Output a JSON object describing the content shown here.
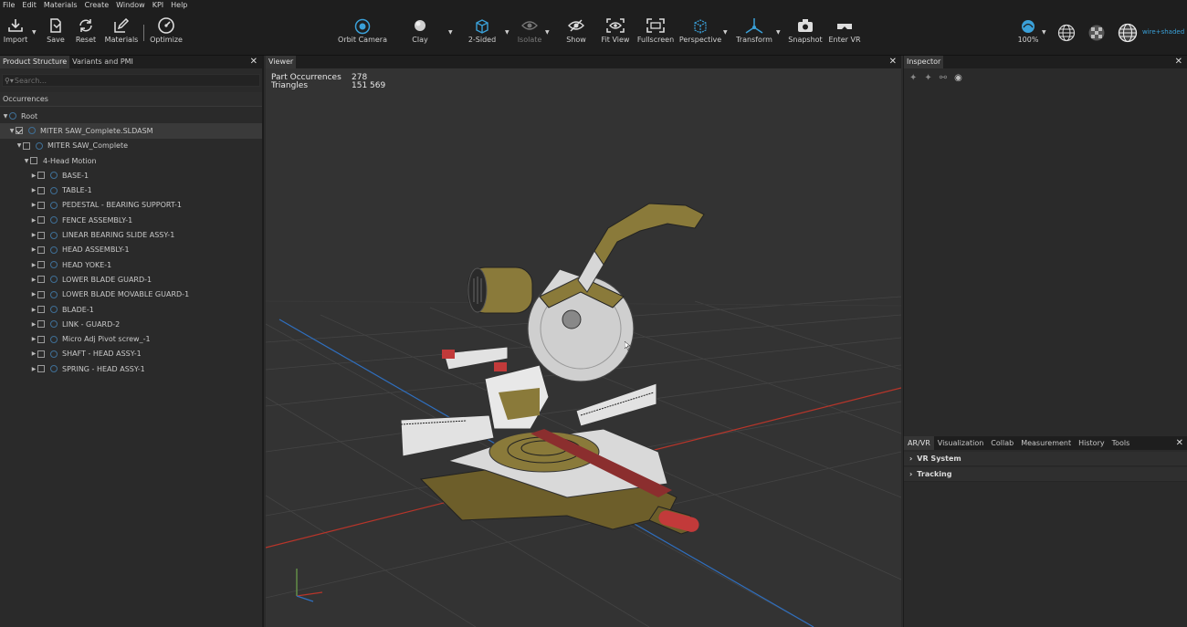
{
  "menu": [
    "File",
    "Edit",
    "Materials",
    "Create",
    "Window",
    "KPI",
    "Help"
  ],
  "toolbar": {
    "import": "Import",
    "save": "Save",
    "reset": "Reset",
    "materials": "Materials",
    "optimize": "Optimize",
    "orbit_camera": "Orbit Camera",
    "clay": "Clay",
    "two_sided": "2-Sided",
    "isolate": "Isolate",
    "show": "Show",
    "fit_view": "Fit View",
    "fullscreen": "Fullscreen",
    "perspective": "Perspective",
    "transform": "Transform",
    "snapshot": "Snapshot",
    "enter_vr": "Enter VR",
    "zoom": "100%",
    "render_mode": "wire+shaded"
  },
  "left_panel": {
    "tabs": [
      "Product Structure",
      "Variants and PMI"
    ],
    "search_placeholder": "Search...",
    "header": "Occurrences",
    "tree": [
      {
        "label": "Root",
        "depth": 0,
        "expanded": true,
        "has_checkbox": false
      },
      {
        "label": "MITER SAW_Complete.SLDASM",
        "depth": 1,
        "expanded": true,
        "has_checkbox": true,
        "checked": true,
        "selected": true
      },
      {
        "label": "MITER SAW_Complete",
        "depth": 2,
        "expanded": true,
        "has_checkbox": true,
        "checked": false
      },
      {
        "label": "4-Head Motion",
        "depth": 3,
        "expanded": true,
        "has_checkbox": true,
        "checked": false,
        "no_icon": true
      },
      {
        "label": "BASE-1",
        "depth": 4,
        "expanded": false,
        "has_checkbox": true,
        "checked": false
      },
      {
        "label": "TABLE-1",
        "depth": 4,
        "expanded": false,
        "has_checkbox": true,
        "checked": false
      },
      {
        "label": "PEDESTAL - BEARING SUPPORT-1",
        "depth": 4,
        "expanded": false,
        "has_checkbox": true,
        "checked": false
      },
      {
        "label": "FENCE ASSEMBLY-1",
        "depth": 4,
        "expanded": false,
        "has_checkbox": true,
        "checked": false
      },
      {
        "label": "LINEAR BEARING SLIDE ASSY-1",
        "depth": 4,
        "expanded": false,
        "has_checkbox": true,
        "checked": false
      },
      {
        "label": "HEAD ASSEMBLY-1",
        "depth": 4,
        "expanded": false,
        "has_checkbox": true,
        "checked": false
      },
      {
        "label": "HEAD YOKE-1",
        "depth": 4,
        "expanded": false,
        "has_checkbox": true,
        "checked": false
      },
      {
        "label": "LOWER BLADE GUARD-1",
        "depth": 4,
        "expanded": false,
        "has_checkbox": true,
        "checked": false
      },
      {
        "label": "LOWER BLADE MOVABLE GUARD-1",
        "depth": 4,
        "expanded": false,
        "has_checkbox": true,
        "checked": false
      },
      {
        "label": "BLADE-1",
        "depth": 4,
        "expanded": false,
        "has_checkbox": true,
        "checked": false
      },
      {
        "label": "LINK - GUARD-2",
        "depth": 4,
        "expanded": false,
        "has_checkbox": true,
        "checked": false
      },
      {
        "label": "Micro Adj Pivot screw_-1",
        "depth": 4,
        "expanded": false,
        "has_checkbox": true,
        "checked": false
      },
      {
        "label": "SHAFT - HEAD ASSY-1",
        "depth": 4,
        "expanded": false,
        "has_checkbox": true,
        "checked": false
      },
      {
        "label": "SPRING - HEAD ASSY-1",
        "depth": 4,
        "expanded": false,
        "has_checkbox": true,
        "checked": false
      }
    ]
  },
  "viewer": {
    "tab": "Viewer",
    "stats": [
      {
        "label": "Part Occurrences",
        "value": "278"
      },
      {
        "label": "Triangles",
        "value": "151 569"
      }
    ]
  },
  "inspector": {
    "tab": "Inspector",
    "bottom_tabs": [
      "AR/VR",
      "Visualization",
      "Collab",
      "Measurement",
      "History",
      "Tools"
    ],
    "sections": [
      "VR System",
      "Tracking"
    ]
  },
  "colors": {
    "background": "#2b2b2b",
    "viewport": "#333333",
    "toolbar": "#1e1e1e",
    "accent_blue": "#3aa0d8",
    "x_axis": "#c0392b",
    "z_axis": "#2f6fbf",
    "body_olive": "#8a7a3a"
  }
}
